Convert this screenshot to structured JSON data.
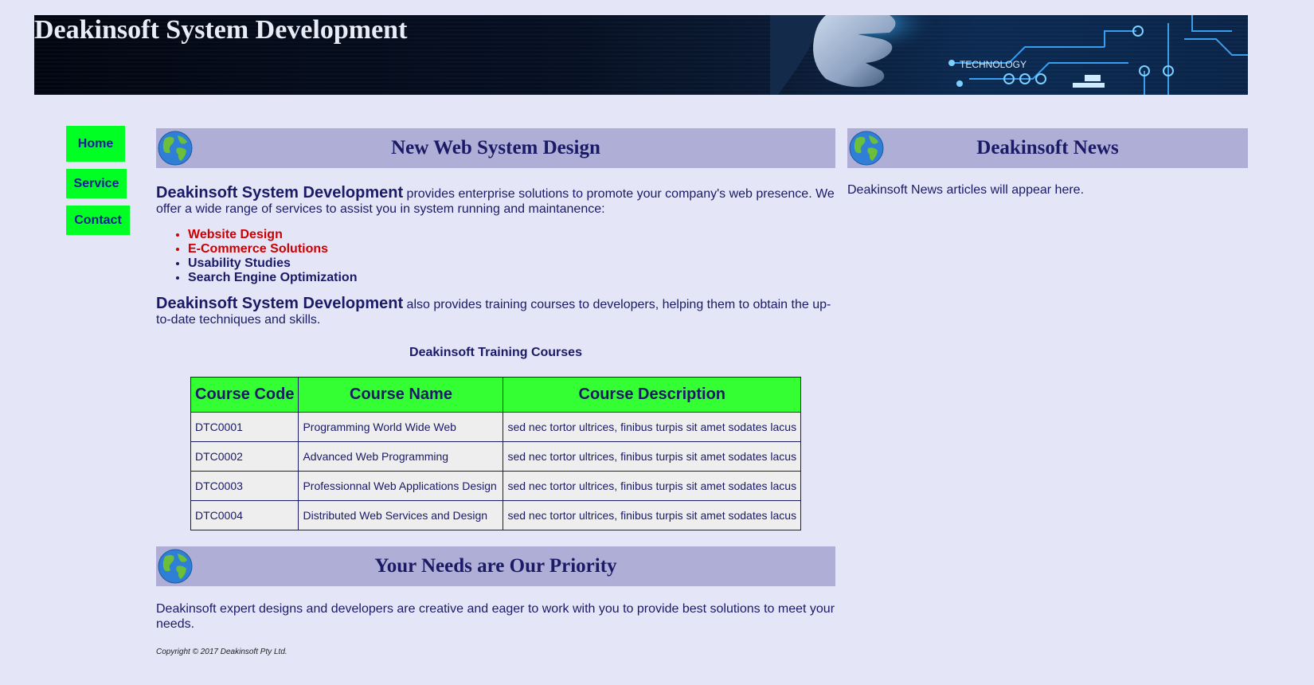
{
  "header": {
    "title": "Deakinsoft System Development",
    "banner_word": "TECHNOLOGY"
  },
  "nav": {
    "items": [
      {
        "label": "Home"
      },
      {
        "label": "Service"
      },
      {
        "label": "Contact"
      }
    ]
  },
  "main": {
    "section1": {
      "heading": "New Web System Design",
      "intro_brand": "Deakinsoft System Development",
      "intro_text": " provides enterprise solutions to promote your company's web presence. We offer a wide range of services to assist you in system running and maintanence:",
      "services": [
        {
          "label": "Website Design"
        },
        {
          "label": "E-Commerce Solutions"
        },
        {
          "label": "Usability Studies"
        },
        {
          "label": "Search Engine Optimization"
        }
      ],
      "training_brand": "Deakinsoft System Development",
      "training_text": " also provides training courses to developers, helping them to obtain the up-to-date techniques and skills.",
      "table_caption": "Deakinsoft Training Courses",
      "table_headers": [
        "Course Code",
        "Course Name",
        "Course Description"
      ],
      "table_rows": [
        [
          "DTC0001",
          "Programming World Wide Web",
          "sed nec tortor ultrices, finibus turpis sit amet sodates lacus"
        ],
        [
          "DTC0002",
          "Advanced Web Programming",
          "sed nec tortor ultrices, finibus turpis sit amet sodates lacus"
        ],
        [
          "DTC0003",
          "Professionnal Web Applications Design",
          "sed nec tortor ultrices, finibus turpis sit amet sodates lacus"
        ],
        [
          "DTC0004",
          "Distributed Web Services and Design",
          "sed nec tortor ultrices, finibus turpis sit amet sodates lacus"
        ]
      ]
    },
    "section2": {
      "heading": "Your Needs are Our Priority",
      "text": "Deakinsoft expert designs and developers are creative and eager to work with you to provide best solutions to meet your needs."
    },
    "copyright": "Copyright © 2017 Deakinsoft Pty Ltd."
  },
  "sidebar": {
    "heading": "Deakinsoft News",
    "text": "Deakinsoft News articles will appear here."
  },
  "colors": {
    "background": "#e5e5f8",
    "text": "#1a1a66",
    "heading_band": "#aeaed6",
    "nav_button": "#00ff22",
    "table_header": "#33ff33",
    "table_cell": "#eeeeee",
    "highlight": "#cc0000"
  },
  "icons": {
    "section_icon": "globe-icon",
    "banner_icon": "hand-circuit-art"
  }
}
